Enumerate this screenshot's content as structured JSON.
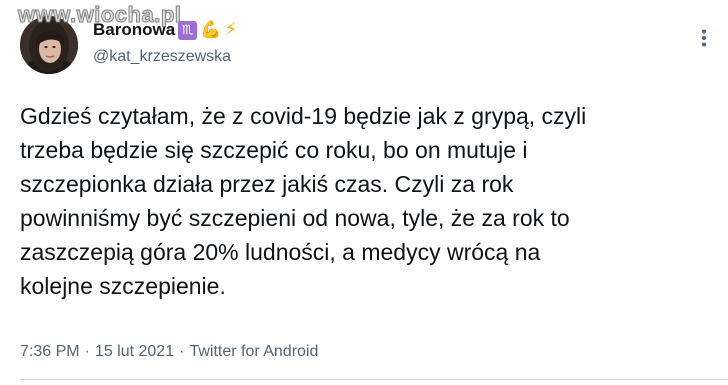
{
  "watermark": "www.wiocha.pl",
  "user": {
    "display_name": "Baronowa",
    "zodiac_emoji": "♏",
    "arm_emoji": "💪",
    "bolt_emoji": "⚡",
    "handle": "@kat_krzeszewska"
  },
  "tweet": {
    "text": "Gdzieś czytałam, że z covid-19 będzie jak z grypą, czyli\ntrzeba będzie się szczepić co roku, bo on mutuje i\nszczepionka działa przez jakiś czas. Czyli za rok\npowinniśmy być szczepieni od nowa, tyle, że za rok to\nzaszczepią góra 20% ludności, a medycy wrócą na\nkolejne szczepienie."
  },
  "meta": {
    "time": "7:36 PM",
    "separator": "·",
    "date": "15 lut 2021",
    "source": "Twitter for Android"
  },
  "colors": {
    "text_primary": "#0f1419",
    "text_secondary": "#536471",
    "divider": "#cfd9de"
  },
  "icons": {
    "more": "more-vertical-icon"
  }
}
